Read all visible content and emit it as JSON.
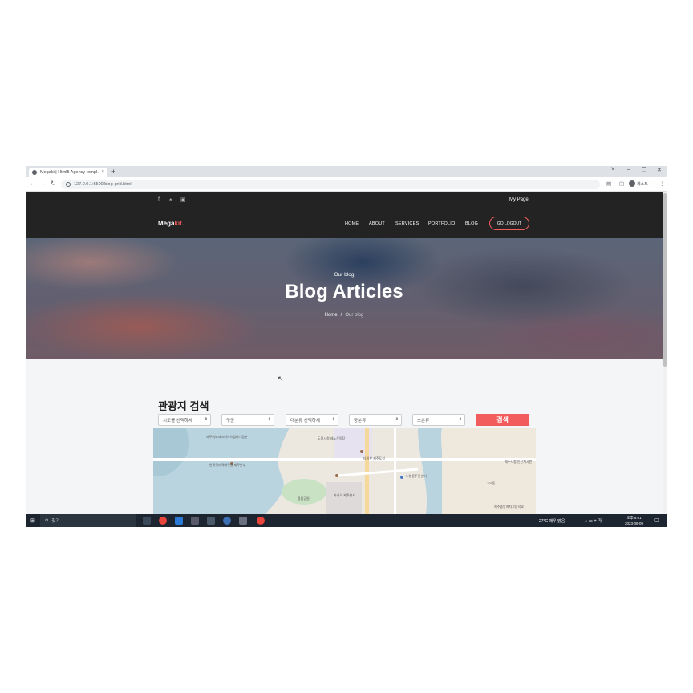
{
  "browser": {
    "tab_title": "Megakit| Html5 Agency templ…",
    "tab_close": "×",
    "new_tab": "+",
    "url": "127.0.0.1:5500/blog-grid.html",
    "profile_label": "게스트",
    "window_controls": [
      "˅",
      "–",
      "❐",
      "✕"
    ]
  },
  "site": {
    "topbar": {
      "my_page": "My Page",
      "social_icons": [
        "facebook-icon",
        "twitter-icon",
        "github-icon"
      ]
    },
    "logo": {
      "main": "Mega",
      "accent": "kit."
    },
    "nav": [
      "HOME",
      "ABOUT",
      "SERVICES",
      "PORTFOLIO",
      "BLOG"
    ],
    "logout_label": "GO LOGOUT",
    "hero": {
      "subtitle": "Our blog",
      "title": "Blog Articles",
      "breadcrumb_home": "Home",
      "breadcrumb_sep": "/",
      "breadcrumb_current": "Our blog"
    },
    "search": {
      "title": "관광지 검색",
      "selects": [
        "시도를 선택하세",
        "구군",
        "대분류 선택하세",
        "중분류",
        "소분류"
      ],
      "button": "검색"
    },
    "map_labels": [
      "제주미노파크미어스점바다림분",
      "한국국미력배구원 제주본부",
      "도림시청 제노운동장",
      "타귀분 제주도청",
      "용담공원",
      "카카오 제주본사",
      "노형동주민센터",
      "105동",
      "제주시청 인근게시판",
      "제주중앙여자고등학교"
    ]
  },
  "taskbar": {
    "search_label": "찾기",
    "weather": "27°C 매우 맑음",
    "tray": "˄ ▭ ⌗ 가",
    "time": "오후 6:01",
    "date": "2023-09-09"
  },
  "colors": {
    "accent": "#f25c5c",
    "header_bg": "#232323"
  }
}
